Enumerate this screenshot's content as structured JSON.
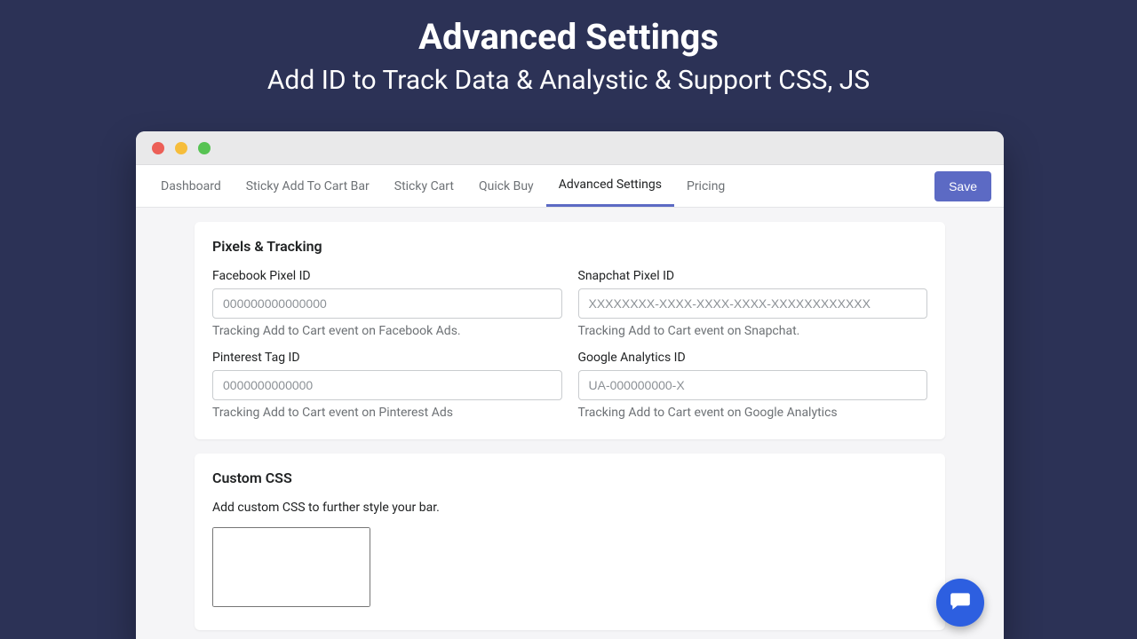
{
  "hero": {
    "title": "Advanced Settings",
    "subtitle": "Add ID to Track Data & Analystic & Support CSS, JS"
  },
  "tabs": [
    {
      "label": "Dashboard"
    },
    {
      "label": "Sticky Add To Cart Bar"
    },
    {
      "label": "Sticky Cart"
    },
    {
      "label": "Quick Buy"
    },
    {
      "label": "Advanced Settings"
    },
    {
      "label": "Pricing"
    }
  ],
  "save_label": "Save",
  "pixels": {
    "heading": "Pixels & Tracking",
    "facebook": {
      "label": "Facebook Pixel ID",
      "placeholder": "000000000000000",
      "help": "Tracking Add to Cart event on Facebook Ads."
    },
    "snapchat": {
      "label": "Snapchat Pixel ID",
      "placeholder": "XXXXXXXX-XXXX-XXXX-XXXX-XXXXXXXXXXXX",
      "help": "Tracking Add to Cart event on Snapchat."
    },
    "pinterest": {
      "label": "Pinterest Tag ID",
      "placeholder": "0000000000000",
      "help": "Tracking Add to Cart event on Pinterest Ads"
    },
    "google": {
      "label": "Google Analytics ID",
      "placeholder": "UA-000000000-X",
      "help": "Tracking Add to Cart event on Google Analytics"
    }
  },
  "custom_css": {
    "heading": "Custom CSS",
    "description": "Add custom CSS to further style your bar."
  }
}
